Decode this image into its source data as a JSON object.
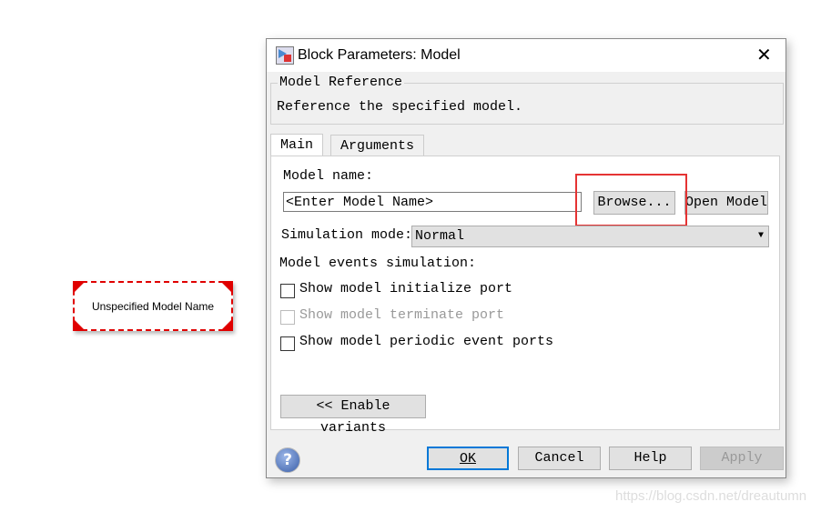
{
  "block": {
    "label": "Unspecified Model Name"
  },
  "dialog": {
    "title": "Block Parameters: Model",
    "group_title": "Model Reference",
    "description": "Reference the specified model.",
    "tabs": [
      {
        "label": "Main"
      },
      {
        "label": "Arguments"
      }
    ],
    "model_name_label": "Model name:",
    "model_name_value": "<Enter Model Name>",
    "browse": "Browse...",
    "open_model": "Open Model",
    "sim_mode_label": "Simulation mode:",
    "sim_mode_value": "Normal",
    "events_label": "Model events simulation:",
    "checks": [
      {
        "label": "Show model initialize port",
        "checked": false,
        "enabled": true
      },
      {
        "label": "Show model terminate port",
        "checked": false,
        "enabled": false
      },
      {
        "label": "Show model periodic event ports",
        "checked": false,
        "enabled": true
      }
    ],
    "variants": "<< Enable variants",
    "buttons": {
      "ok": "OK",
      "cancel": "Cancel",
      "help": "Help",
      "apply": "Apply"
    }
  },
  "highlight_color": "#e53333",
  "watermark": "https://blog.csdn.net/dreautumn"
}
